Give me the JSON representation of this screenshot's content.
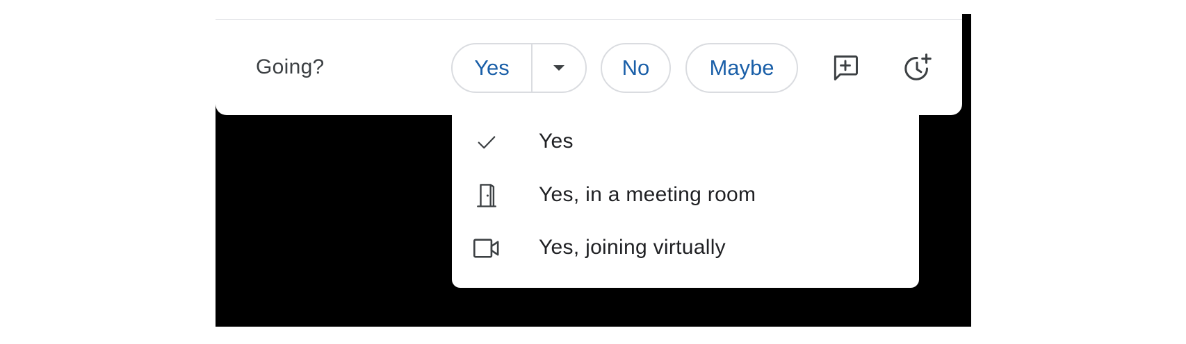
{
  "rsvp": {
    "question": "Going?",
    "yes_label": "Yes",
    "no_label": "No",
    "maybe_label": "Maybe",
    "dropdown_icon": "chevron-down-icon",
    "add_note_icon": "add-note-icon",
    "propose_time_icon": "propose-new-time-icon"
  },
  "menu": {
    "items": [
      {
        "label": "Yes",
        "icon": "check-icon",
        "selected": true
      },
      {
        "label": "Yes, in a meeting room",
        "icon": "door-icon",
        "selected": false
      },
      {
        "label": "Yes, joining virtually",
        "icon": "video-camera-icon",
        "selected": false
      }
    ]
  },
  "colors": {
    "accent": "#1a5fa8",
    "border": "#dadce0",
    "text": "#202124",
    "backdrop": "#000000"
  }
}
